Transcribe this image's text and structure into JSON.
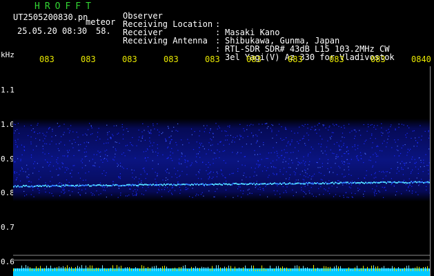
{
  "header": {
    "app_title": "HROFFT",
    "file_name": "UT2505200830.pn",
    "meteor_label": "meteor",
    "timestamp": "25.05.20 08:30",
    "count": "58."
  },
  "info": [
    {
      "label": "Observer",
      "value": "Masaki Kano"
    },
    {
      "label": "Receiving Location",
      "value": "Shibukawa, Gunma, Japan"
    },
    {
      "label": "Receiver",
      "value": "RTL-SDR SDR# 43dB L15 103.2MHz CW"
    },
    {
      "label": "Receiving Antenna",
      "value": "3el Yagi(V) Az 330 for Vladivostok"
    }
  ],
  "axis": {
    "y_unit": "kHz",
    "y_ticks": [
      "1.1",
      "1.0",
      "0.9",
      "0.8",
      "0.7",
      "0.6"
    ],
    "time_ticks": [
      "083",
      "083",
      "083",
      "083",
      "083",
      "083",
      "083",
      "083",
      "083",
      "0840"
    ]
  },
  "colors": {
    "background": "#000000",
    "title_green": "#33d633",
    "time_yellow": "#e8e800",
    "noise_blue": "#1a2cff",
    "signal_cyan": "#4fd8ff",
    "bottom_bar": "#00c8ff",
    "bottom_spikes": "#e8e800"
  }
}
